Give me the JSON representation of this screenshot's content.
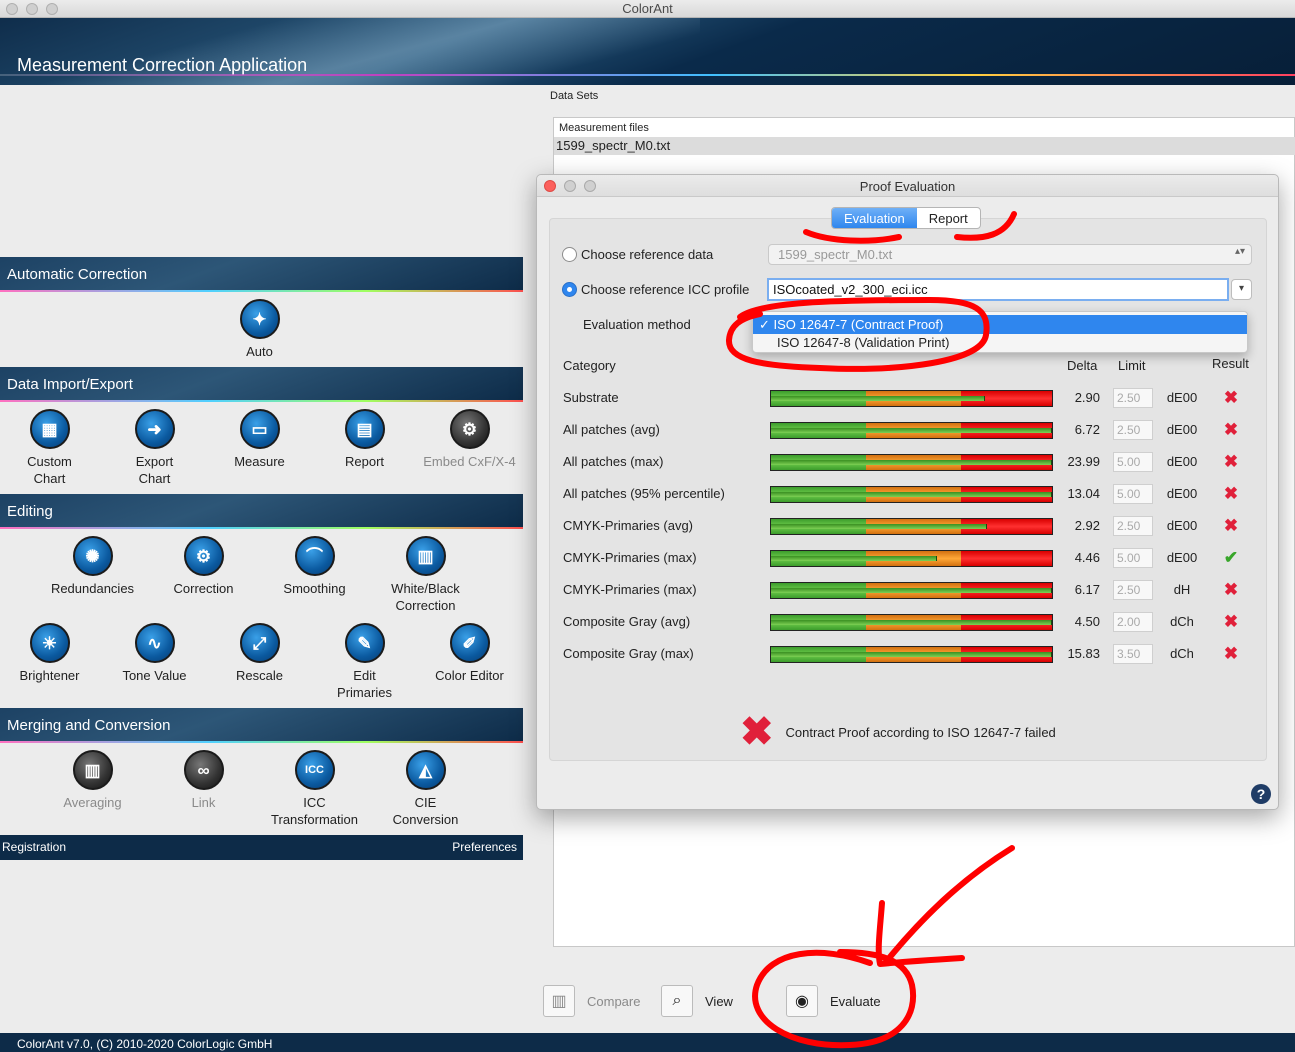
{
  "window": {
    "title": "ColorAnt"
  },
  "app": {
    "header_title": "Measurement Correction Application",
    "status": "ColorAnt v7.0, (C) 2010-2020 ColorLogic GmbH"
  },
  "sections": {
    "automatic": {
      "title": "Automatic Correction",
      "auto": "Auto"
    },
    "import_export": {
      "title": "Data Import/Export",
      "custom_chart": "Custom\nChart",
      "export_chart": "Export\nChart",
      "measure": "Measure",
      "report": "Report",
      "embed": "Embed CxF/X-4"
    },
    "editing": {
      "title": "Editing",
      "redundancies": "Redundancies",
      "correction": "Correction",
      "smoothing": "Smoothing",
      "white_black": "White/Black\nCorrection",
      "brightener": "Brightener",
      "tone_value": "Tone Value",
      "rescale": "Rescale",
      "edit_primaries": "Edit\nPrimaries",
      "color_editor": "Color Editor"
    },
    "merging": {
      "title": "Merging and Conversion",
      "averaging": "Averaging",
      "link": "Link",
      "icc": "ICC\nTransformation",
      "cie": "CIE\nConversion"
    }
  },
  "footer": {
    "registration": "Registration",
    "preferences": "Preferences"
  },
  "datasets": {
    "label": "Data Sets",
    "files_header": "Measurement files",
    "file1": "1599_spectr_M0.txt"
  },
  "bottom_toolbar": {
    "compare": "Compare",
    "view": "View",
    "evaluate": "Evaluate"
  },
  "dialog": {
    "title": "Proof Evaluation",
    "tabs": {
      "evaluation": "Evaluation",
      "report": "Report"
    },
    "ref_data_label": "Choose reference data",
    "ref_data_value": "1599_spectr_M0.txt",
    "ref_icc_label": "Choose reference ICC profile",
    "ref_icc_value": "ISOcoated_v2_300_eci.icc",
    "method_label": "Evaluation method",
    "method_options": {
      "selected": "✓ ISO 12647-7 (Contract Proof)",
      "other": "ISO 12647-8 (Validation Print)"
    },
    "headers": {
      "category": "Category",
      "delta": "Delta",
      "limit": "Limit",
      "result": "Result"
    },
    "rows": [
      {
        "category": "Substrate",
        "delta": "2.90",
        "limit": "2.50",
        "unit": "dE00",
        "result": "fail",
        "fill": 0.76
      },
      {
        "category": "All patches (avg)",
        "delta": "6.72",
        "limit": "2.50",
        "unit": "dE00",
        "result": "fail",
        "fill": 1.0
      },
      {
        "category": "All patches (max)",
        "delta": "23.99",
        "limit": "5.00",
        "unit": "dE00",
        "result": "fail",
        "fill": 1.0
      },
      {
        "category": "All patches (95% percentile)",
        "delta": "13.04",
        "limit": "5.00",
        "unit": "dE00",
        "result": "fail",
        "fill": 1.0
      },
      {
        "category": "CMYK-Primaries (avg)",
        "delta": "2.92",
        "limit": "2.50",
        "unit": "dE00",
        "result": "fail",
        "fill": 0.77
      },
      {
        "category": "CMYK-Primaries (max)",
        "delta": "4.46",
        "limit": "5.00",
        "unit": "dE00",
        "result": "pass",
        "fill": 0.59
      },
      {
        "category": "CMYK-Primaries (max)",
        "delta": "6.17",
        "limit": "2.50",
        "unit": "dH",
        "result": "fail",
        "fill": 1.0
      },
      {
        "category": "Composite Gray (avg)",
        "delta": "4.50",
        "limit": "2.00",
        "unit": "dCh",
        "result": "fail",
        "fill": 1.0
      },
      {
        "category": "Composite Gray (max)",
        "delta": "15.83",
        "limit": "3.50",
        "unit": "dCh",
        "result": "fail",
        "fill": 1.0
      }
    ],
    "verdict": "Contract Proof according to ISO 12647-7 failed",
    "help": "?"
  },
  "colors": {
    "annotation": "#ff0000",
    "accent": "#2f86ee",
    "fail": "#e0203a",
    "pass": "#38a62a"
  }
}
